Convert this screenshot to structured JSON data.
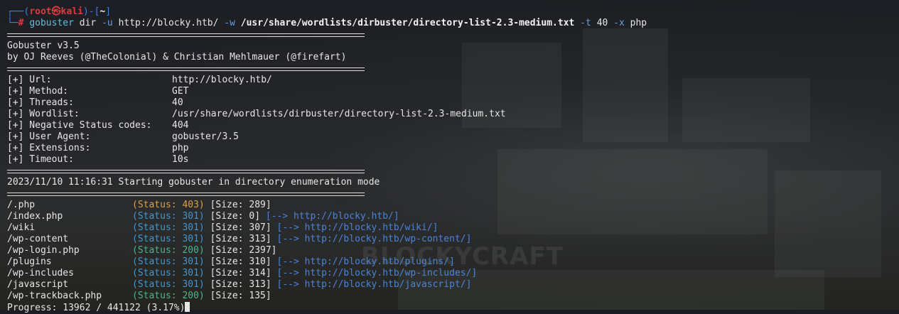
{
  "prompt": {
    "open": "┌──(",
    "user": "root㉿kali",
    "mid": ")-[",
    "dir": "~",
    "close": "]",
    "line2_prefix": "└─",
    "hash": "#"
  },
  "command": {
    "program": "gobuster",
    "sub": "dir",
    "flag_u": "-u",
    "url": "http://blocky.htb/",
    "flag_w": "-w",
    "wordlist": "/usr/share/wordlists/dirbuster/directory-list-2.3-medium.txt",
    "flag_t": "-t",
    "threads": "40",
    "flag_x": "-x",
    "ext": "php"
  },
  "banner": {
    "version": "Gobuster v3.5",
    "authors": "by OJ Reeves (@TheColonial) & Christian Mehlmauer (@firefart)"
  },
  "config": [
    {
      "key": "[+] Url:",
      "value": "http://blocky.htb/"
    },
    {
      "key": "[+] Method:",
      "value": "GET"
    },
    {
      "key": "[+] Threads:",
      "value": "40"
    },
    {
      "key": "[+] Wordlist:",
      "value": "/usr/share/wordlists/dirbuster/directory-list-2.3-medium.txt"
    },
    {
      "key": "[+] Negative Status codes:",
      "value": "404"
    },
    {
      "key": "[+] User Agent:",
      "value": "gobuster/3.5"
    },
    {
      "key": "[+] Extensions:",
      "value": "php"
    },
    {
      "key": "[+] Timeout:",
      "value": "10s"
    }
  ],
  "start_message": "2023/11/10 11:16:31 Starting gobuster in directory enumeration mode",
  "results": [
    {
      "path": "/.php",
      "status": "(Status: 403)",
      "size": "[Size: 289]",
      "redirect": ""
    },
    {
      "path": "/index.php",
      "status": "(Status: 301)",
      "size": "[Size: 0]",
      "redirect": "[--> http://blocky.htb/]"
    },
    {
      "path": "/wiki",
      "status": "(Status: 301)",
      "size": "[Size: 307]",
      "redirect": "[--> http://blocky.htb/wiki/]"
    },
    {
      "path": "/wp-content",
      "status": "(Status: 301)",
      "size": "[Size: 313]",
      "redirect": "[--> http://blocky.htb/wp-content/]"
    },
    {
      "path": "/wp-login.php",
      "status": "(Status: 200)",
      "size": "[Size: 2397]",
      "redirect": ""
    },
    {
      "path": "/plugins",
      "status": "(Status: 301)",
      "size": "[Size: 310]",
      "redirect": "[--> http://blocky.htb/plugins/]"
    },
    {
      "path": "/wp-includes",
      "status": "(Status: 301)",
      "size": "[Size: 314]",
      "redirect": "[--> http://blocky.htb/wp-includes/]"
    },
    {
      "path": "/javascript",
      "status": "(Status: 301)",
      "size": "[Size: 313]",
      "redirect": "[--> http://blocky.htb/javascript/]"
    },
    {
      "path": "/wp-trackback.php",
      "status": "(Status: 200)",
      "size": "[Size: 135]",
      "redirect": ""
    }
  ],
  "progress": "Progress: 13962 / 441122 (3.17%)",
  "watermark": "BLOCKYCRAFT"
}
